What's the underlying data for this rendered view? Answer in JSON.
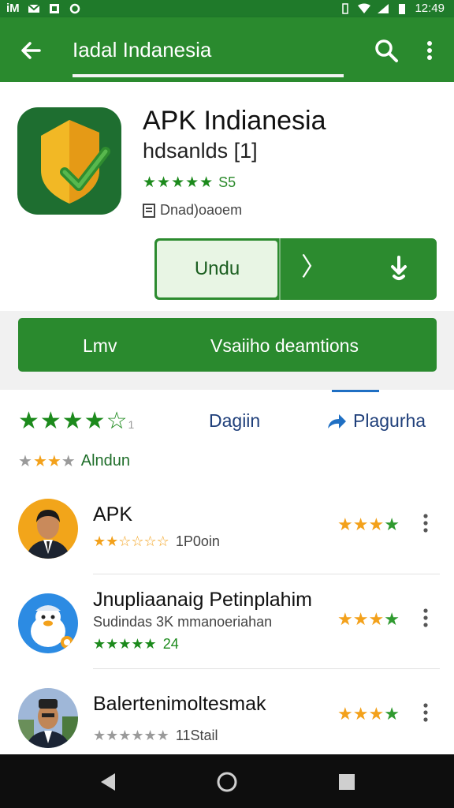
{
  "status_bar": {
    "left_text": "iM",
    "time": "12:49",
    "icons": [
      "gmail-icon",
      "photo-icon",
      "location-icon",
      "vibrate-icon",
      "wifi-icon",
      "signal-icon",
      "battery-icon"
    ]
  },
  "app_bar": {
    "title": "Iadal Indanesia",
    "back_icon": "arrow-left-icon",
    "search_icon": "search-icon",
    "more_icon": "more-vert-icon"
  },
  "app": {
    "name": "APK Indianesia",
    "developer": "hdsanlds [1]",
    "rating_stars": "★★★★★",
    "rating_value": "S5",
    "meta_text": "Dnad)oaoem",
    "install_label": "Undu",
    "chevron_label": "〉",
    "download_icon": "download-icon",
    "icon_colors": {
      "bg": "#1e6e30",
      "shield": "#f2b825",
      "check": "#3aa64a"
    }
  },
  "banner": {
    "left_label": "Lmv",
    "right_label": "Vsaiiho deamtions"
  },
  "reviews_header": {
    "stars": "★★★★",
    "empty_star": "☆",
    "stars_suffix": "1",
    "tab1": "Dagiin",
    "tab2": "Plagurha",
    "sub_stars_grey": "★",
    "sub_stars_orange": "★★",
    "sub_stars_grey2": "★",
    "sub_label": "Alndun"
  },
  "list": [
    {
      "name": "APK",
      "rating_text": "★★☆☆☆☆",
      "sub_value": "1P0oin",
      "right_stars": "★★",
      "avatar": "avatar-man-suit"
    },
    {
      "name": "Jnupliaanaig Petinplahim",
      "subtitle": "Sudindas 3K mmanoeriahan",
      "rating_text": "★★★★★",
      "sub_value": "24",
      "right_stars": "★★",
      "avatar": "avatar-cartoon-duck"
    },
    {
      "name": "Balertenimoltesmak",
      "rating_text": "★★★★★★",
      "sub_value": "11Stail",
      "right_stars": "★★",
      "avatar": "avatar-man-cap"
    }
  ],
  "nav": {
    "back": "nav-back-icon",
    "home": "nav-home-icon",
    "recents": "nav-recents-icon"
  },
  "colors": {
    "primary": "#2a8a2e",
    "status": "#1f7a2a",
    "accent_blue": "#1f6fc3",
    "star_orange": "#f3a11b"
  }
}
